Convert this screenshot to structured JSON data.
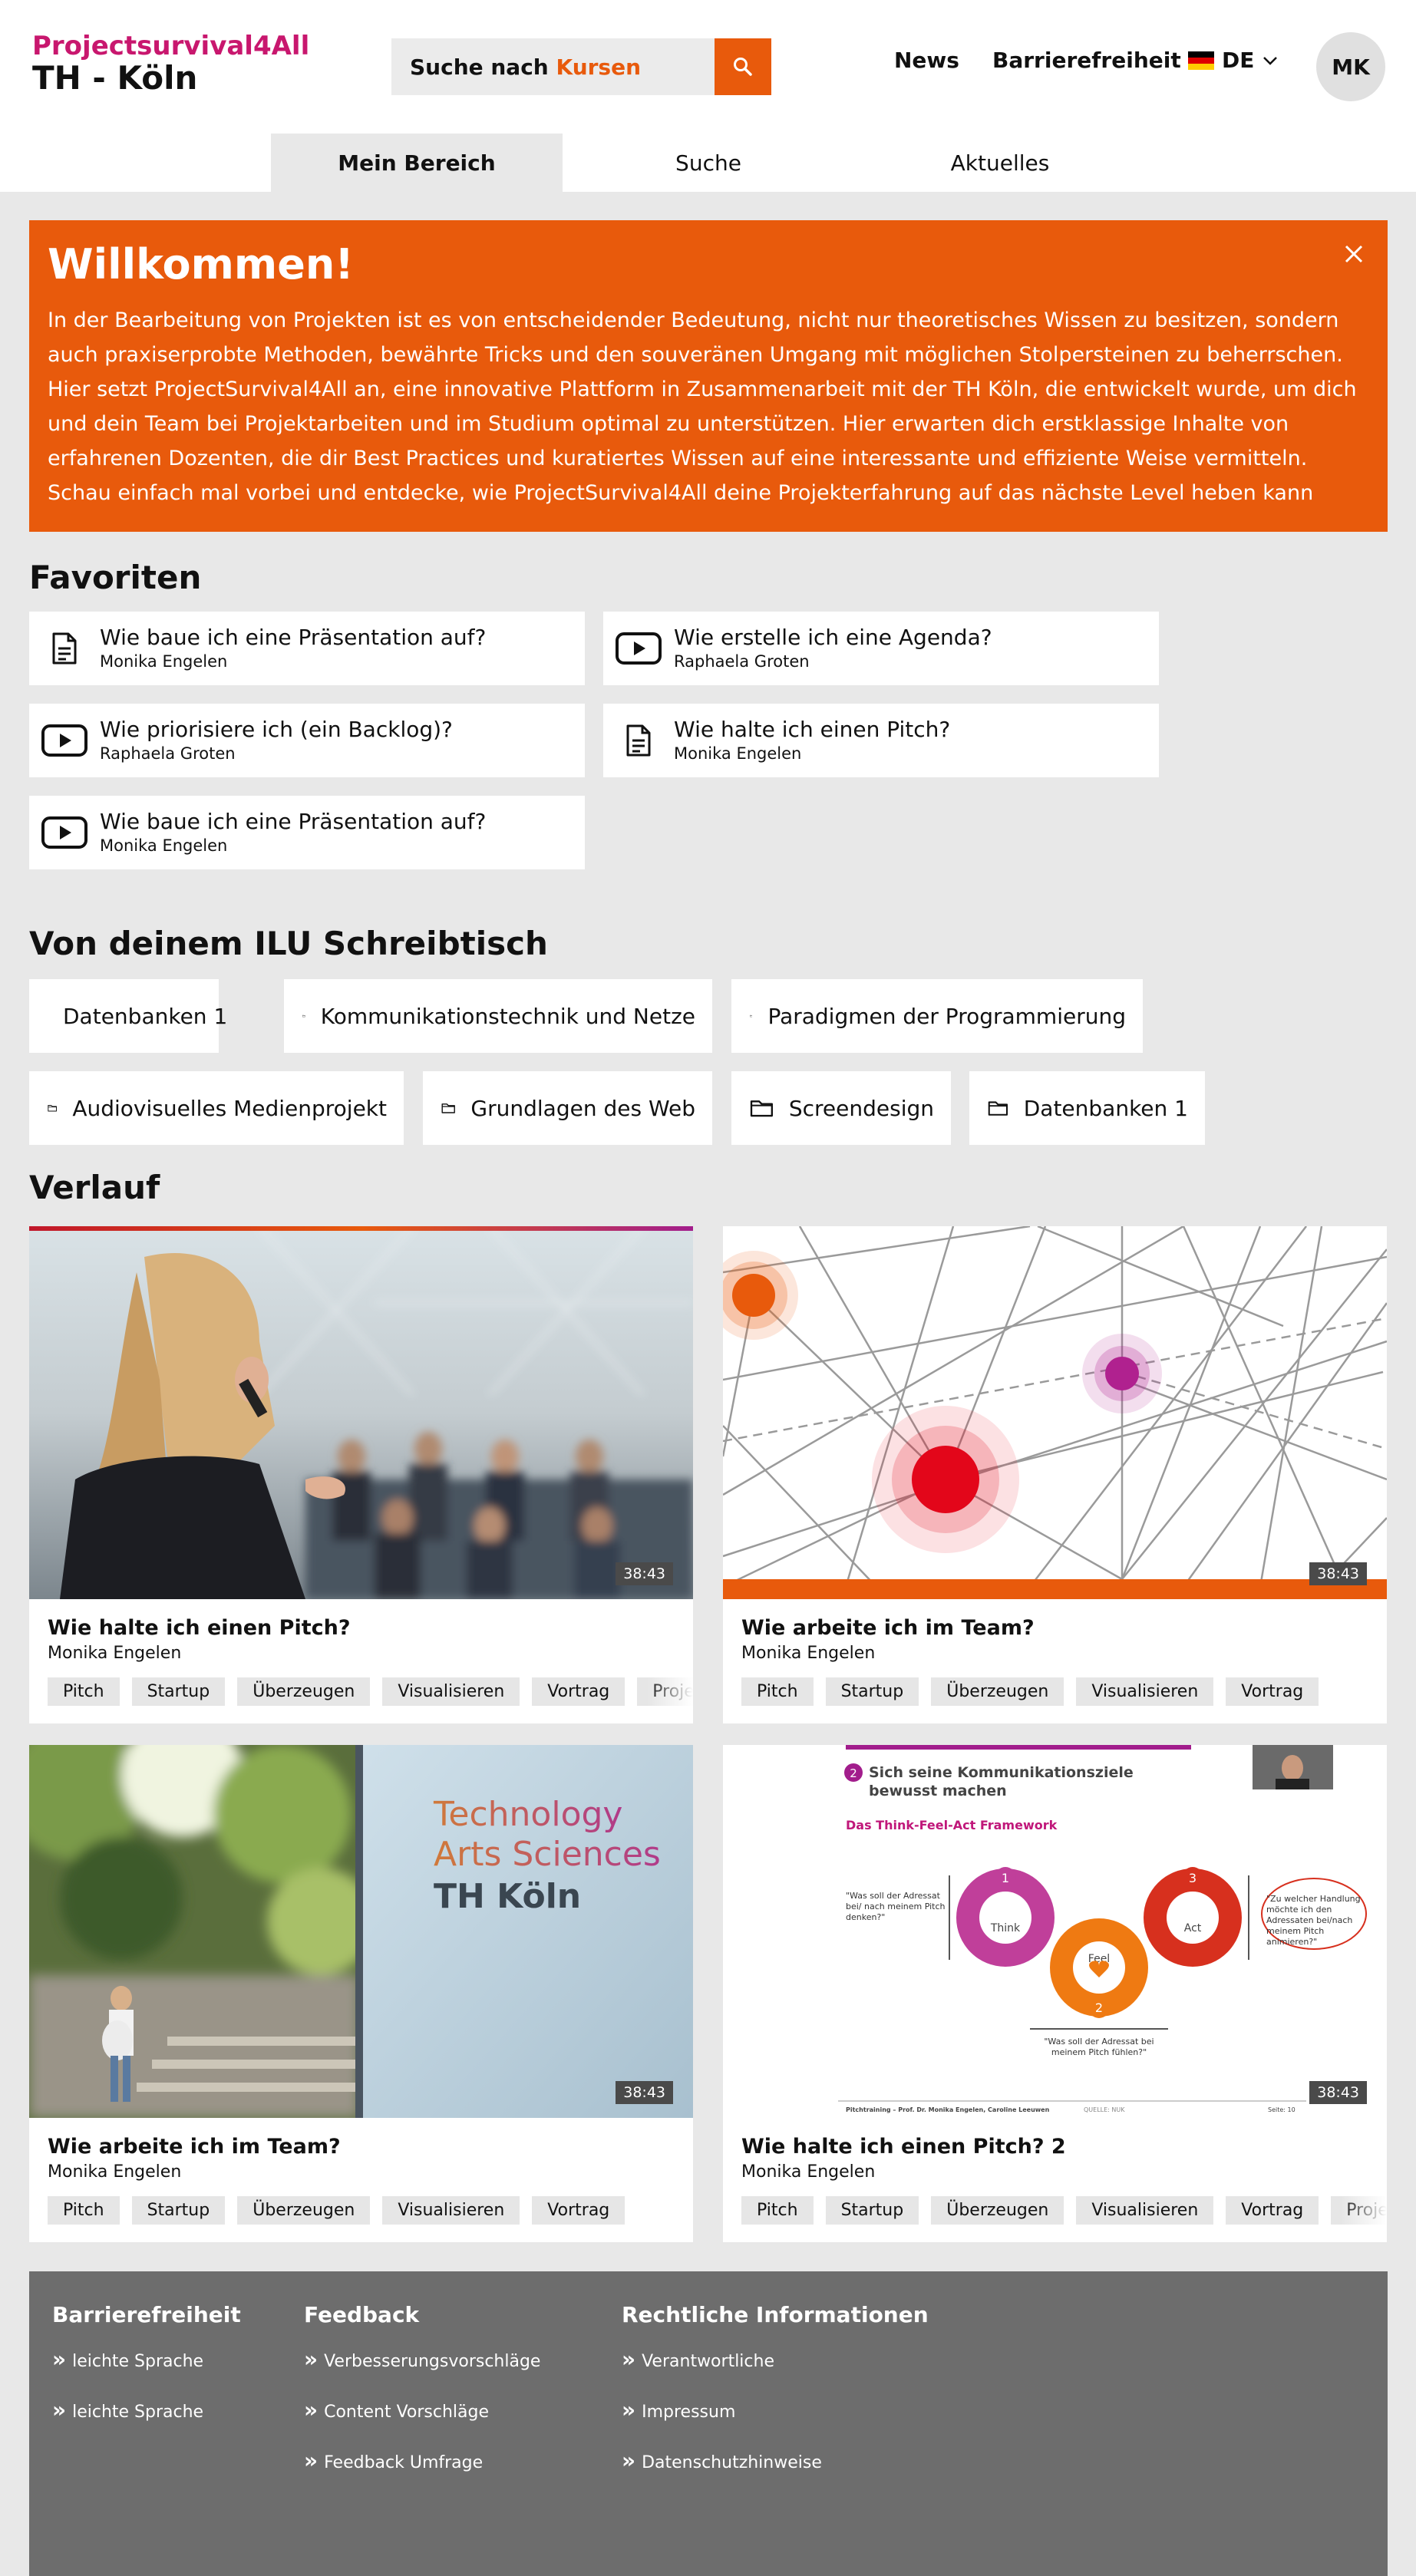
{
  "header": {
    "logo_line1": "Projectsurvival4All",
    "logo_line2": "TH - Köln",
    "search_prefix": "Suche nach",
    "search_accent": "Kursen",
    "nav_news": "News",
    "nav_accessibility": "Barrierefreiheit",
    "lang": "DE",
    "avatar_initials": "MK",
    "tabs": [
      "Mein Bereich",
      "Suche",
      "Aktuelles"
    ],
    "accent_color": "#e85a0c",
    "brand_color": "#c8176e"
  },
  "welcome": {
    "title": "Willkommen!",
    "text": "In der Bearbeitung von Projekten ist es von entscheidender Bedeutung, nicht nur theoretisches Wissen zu besitzen, sondern auch praxiserprobte Methoden, bewährte Tricks und den souveränen Umgang mit möglichen Stolpersteinen zu beherrschen. Hier setzt ProjectSurvival4All an, eine innovative Plattform in Zusammenarbeit mit der TH Köln, die entwickelt wurde, um dich und dein Team bei Projektarbeiten und im Studium optimal zu unterstützen. Hier erwarten dich erstklassige Inhalte von erfahrenen Dozenten, die dir Best Practices und kuratiertes Wissen auf eine interessante und effiziente Weise vermitteln. Schau einfach mal vorbei und entdecke, wie ProjectSurvival4All deine Projekterfahrung auf das nächste Level heben kann"
  },
  "favorites": {
    "title": "Favoriten",
    "items": [
      {
        "title": "Wie baue ich eine Präsentation auf?",
        "author": "Monika Engelen",
        "icon": "document-icon"
      },
      {
        "title": "Wie erstelle ich eine Agenda?",
        "author": "Raphaela Groten",
        "icon": "video-icon"
      },
      {
        "title": "Wie priorisiere ich (ein Backlog)?",
        "author": "Raphaela Groten",
        "icon": "video-icon"
      },
      {
        "title": "Wie halte ich einen Pitch?",
        "author": "Monika Engelen",
        "icon": "document-icon"
      },
      {
        "title": "Wie baue ich eine Präsentation auf?",
        "author": "Monika Engelen",
        "icon": "video-icon"
      }
    ]
  },
  "desk": {
    "title": "Von deinem ILU Schreibtisch",
    "folders": [
      "Datenbanken 1",
      "Kommunikationstechnik und Netze",
      "Paradigmen der Programmierung",
      "Audiovisuelles Medienprojekt",
      "Grundlagen des Web",
      "Screendesign",
      "Datenbanken 1"
    ]
  },
  "history": {
    "title": "Verlauf",
    "cards": [
      {
        "title": "Wie halte ich einen Pitch?",
        "author": "Monika Engelen",
        "duration": "38:43",
        "tags": [
          "Pitch",
          "Startup",
          "Überzeugen",
          "Visualisieren",
          "Vortrag",
          "Projektidee"
        ]
      },
      {
        "title": "Wie arbeite ich im Team?",
        "author": "Monika Engelen",
        "duration": "38:43",
        "tags": [
          "Pitch",
          "Startup",
          "Überzeugen",
          "Visualisieren",
          "Vortrag"
        ]
      },
      {
        "title": "Wie arbeite ich im Team?",
        "author": "Monika Engelen",
        "duration": "38:43",
        "tags": [
          "Pitch",
          "Startup",
          "Überzeugen",
          "Visualisieren",
          "Vortrag"
        ]
      },
      {
        "title": "Wie halte ich einen Pitch? 2",
        "author": "Monika Engelen",
        "duration": "38:43",
        "tags": [
          "Pitch",
          "Startup",
          "Überzeugen",
          "Visualisieren",
          "Vortrag",
          "Projektstart"
        ]
      }
    ],
    "thumb3_sign": [
      "Technology",
      "Arts Sciences",
      "TH Köln"
    ],
    "thumb4": {
      "step": "2",
      "heading1": "Sich seine Kommunikationsziele",
      "heading2": "bewusst machen",
      "sub": "Das Think-Feel-Act Framework",
      "think": "Think",
      "feel": "Feel",
      "act": "Act",
      "n1": "1",
      "n2": "2",
      "n3": "3",
      "q_left": "\"Was soll der Adressat bei/ nach meinem Pitch denken?\"",
      "q_right": "\"Zu welcher Handlung möchte ich den Adressaten bei/nach meinem Pitch animieren?\"",
      "q_bottom": "\"Was soll der Adressat bei meinem Pitch fühlen?\"",
      "footer_left": "Pitchtraining – Prof. Dr. Monika Engelen, Caroline Leeuwen",
      "footer_mid": "QUELLE: NUK",
      "footer_right": "Seite: 10"
    }
  },
  "footer": {
    "col1_title": "Barrierefreiheit",
    "col1_links": [
      "leichte Sprache",
      "leichte Sprache"
    ],
    "col2_title": "Feedback",
    "col2_links": [
      "Verbesserungsvorschläge",
      "Content Vorschläge",
      "Feedback Umfrage"
    ],
    "col3_title": "Rechtliche Informationen",
    "col3_links": [
      "Verantwortliche",
      "Impressum",
      "Datenschutzhinweise"
    ]
  }
}
